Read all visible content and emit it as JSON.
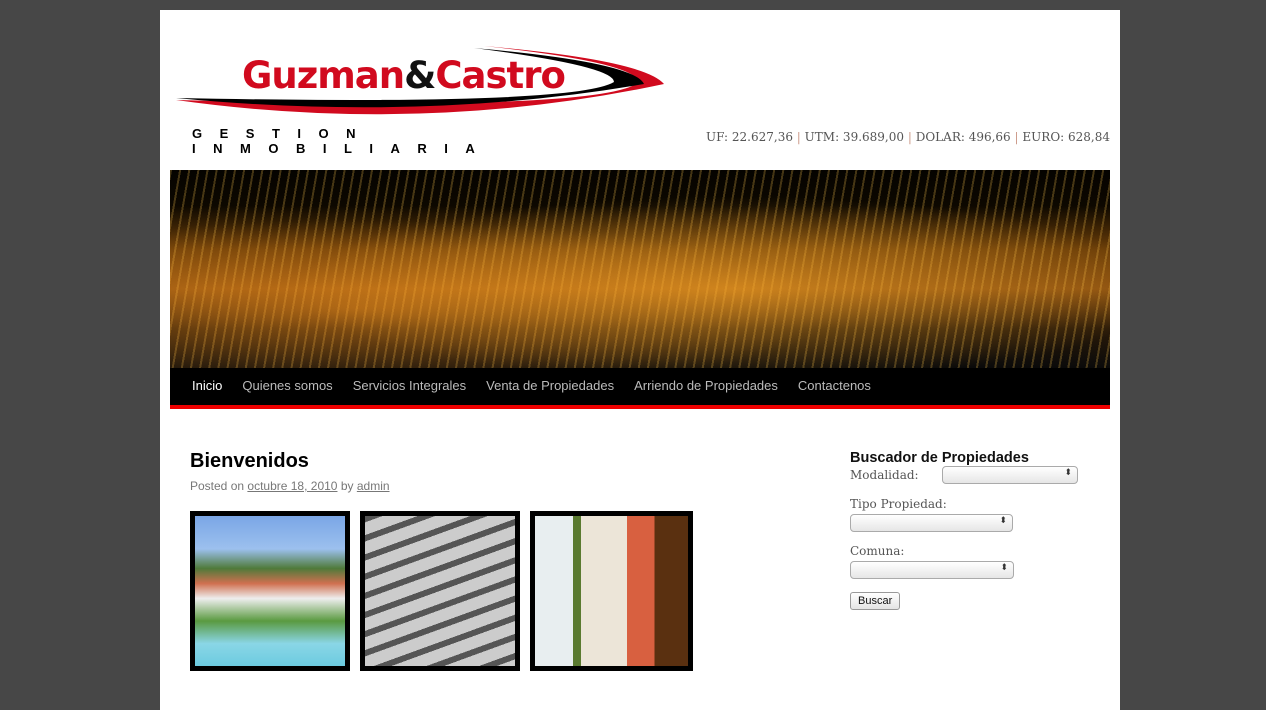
{
  "logo": {
    "brand_part1": "Guzman",
    "brand_amp": "&",
    "brand_part2": "Castro",
    "tagline": "GESTION INMOBILIARIA"
  },
  "rates": {
    "uf": "UF: 22.627,36",
    "utm": "UTM: 39.689,00",
    "dolar": "DOLAR: 496,66",
    "euro": "EURO: 628,84",
    "separator": "|"
  },
  "nav": {
    "items": [
      {
        "label": "Inicio",
        "active": true
      },
      {
        "label": "Quienes somos"
      },
      {
        "label": "Servicios Integrales"
      },
      {
        "label": "Venta de Propiedades"
      },
      {
        "label": "Arriendo de Propiedades"
      },
      {
        "label": "Contactenos"
      }
    ]
  },
  "post": {
    "title": "Bienvenidos",
    "posted_on": "Posted on",
    "date": "octubre 18, 2010",
    "by": "by",
    "author": "admin"
  },
  "search": {
    "title": "Buscador de Propiedades",
    "modalidad_label": "Modalidad:",
    "tipo_label": "Tipo Propiedad:",
    "comuna_label": "Comuna:",
    "button": "Buscar"
  },
  "colors": {
    "brand_red": "#d10a1e",
    "nav_border": "#ee0000"
  }
}
